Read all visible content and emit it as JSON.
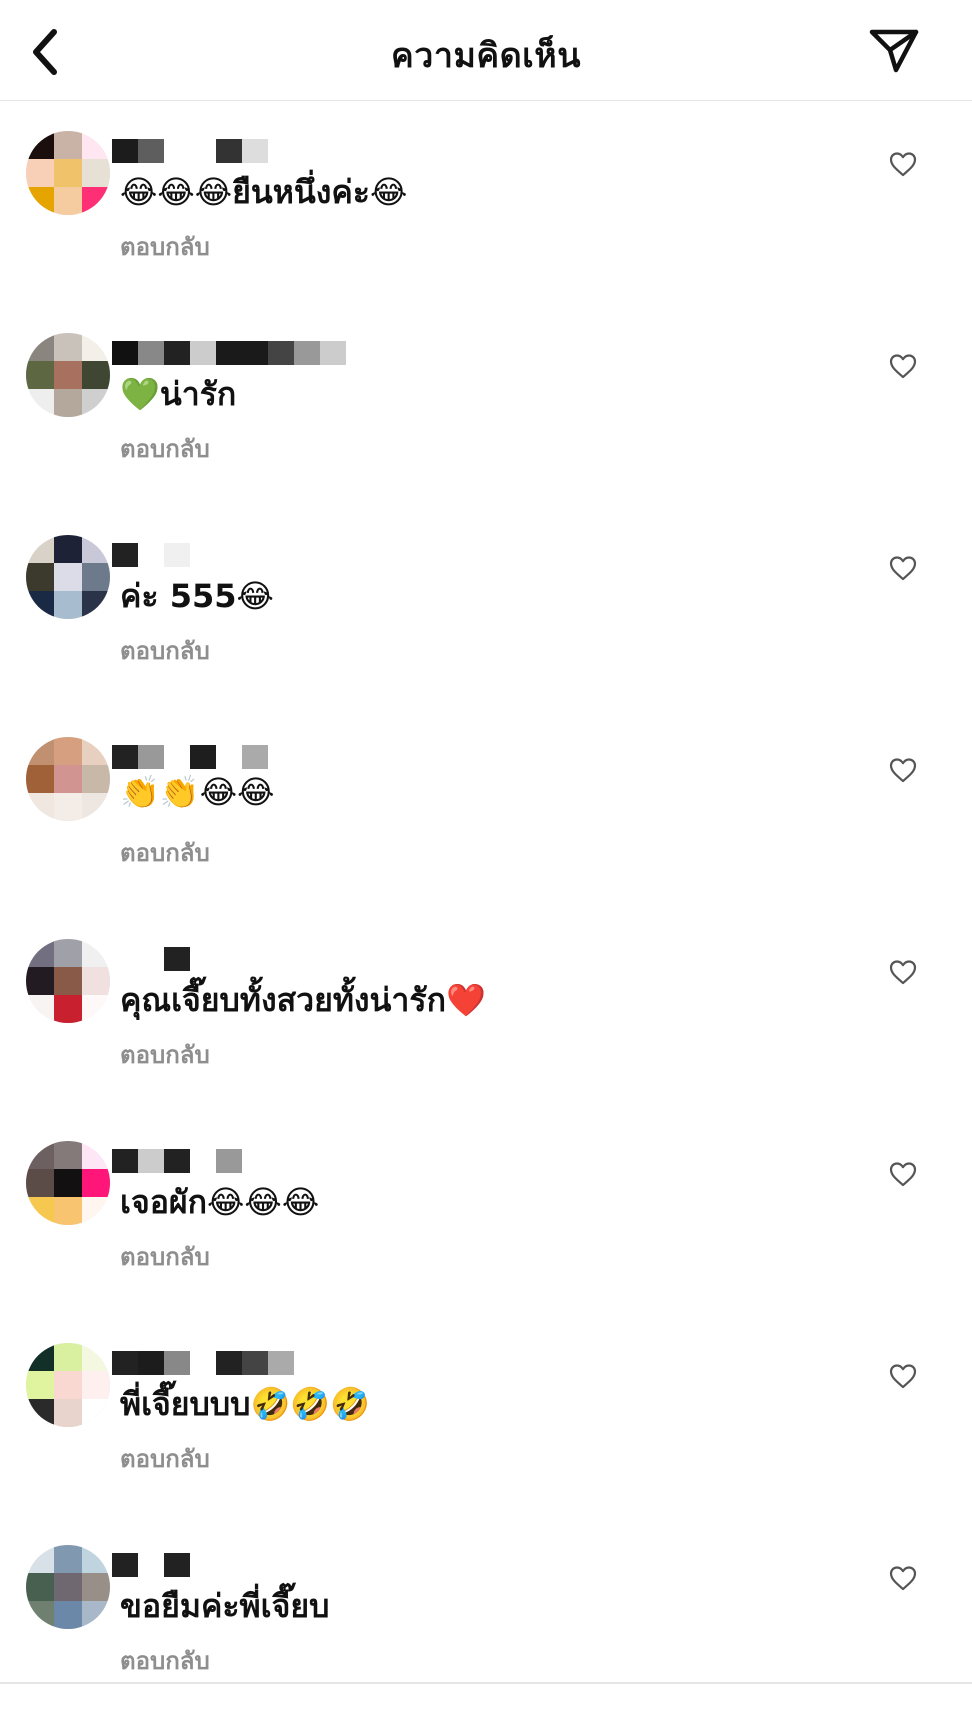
{
  "header": {
    "title": "ความคิดเห็น",
    "back_icon": "chevron-left-icon",
    "send_icon": "paper-plane-icon"
  },
  "comments": [
    {
      "text": "😂😂😂ยืนหนึ่งค่ะ😂",
      "reply": "ตอบกลับ",
      "avatar_colors": [
        "#1a0f0c",
        "#c9b3a6",
        "#ffe6f0",
        "#f8d0b8",
        "#f0c36a",
        "#e7e0d5",
        "#e6a400",
        "#f5cba0",
        "#ff2f75"
      ]
    },
    {
      "text": "💚น่ารัก",
      "reply": "ตอบกลับ",
      "avatar_colors": [
        "#8a857e",
        "#c8c2bb",
        "#f3efe9",
        "#5d6842",
        "#a8705e",
        "#3f4733",
        "#eeeeee",
        "#b4a89c",
        "#cfcfcf"
      ]
    },
    {
      "text": "ค่ะ 555😂",
      "reply": "ตอบกลับ",
      "avatar_colors": [
        "#d9d2c8",
        "#1d2236",
        "#c8c8d8",
        "#3b3a2c",
        "#dcdce8",
        "#6c7a8c",
        "#1a2a44",
        "#a8bcd0",
        "#2a3348"
      ]
    },
    {
      "text": "👏👏😂😂",
      "reply": "ตอบกลับ",
      "avatar_colors": [
        "#c09070",
        "#d6a080",
        "#e8d0c0",
        "#a06038",
        "#d29490",
        "#c8b8a8",
        "#f0e8e0",
        "#f4ece6",
        "#eee6e0"
      ]
    },
    {
      "text": "คุณเจี๊ยบทั้งสวยทั้งน่ารัก❤️",
      "reply": "ตอบกลับ",
      "avatar_colors": [
        "#727080",
        "#a0a0a8",
        "#f0f0f0",
        "#221c22",
        "#8a5a48",
        "#f0e0e0",
        "#f8f4f4",
        "#c8202e",
        "#fff8f8"
      ]
    },
    {
      "text": "เจอผัก😂😂😂",
      "reply": "ตอบกลับ",
      "avatar_colors": [
        "#6c6060",
        "#857a7a",
        "#ffe6f6",
        "#5c4c48",
        "#121010",
        "#ff1678",
        "#f6c850",
        "#f8c470",
        "#fff6f0"
      ]
    },
    {
      "text": "พี่เจี๊ยบบบ🤣🤣🤣",
      "reply": "ตอบกลับ",
      "avatar_colors": [
        "#123028",
        "#d8f0a0",
        "#f4f8e0",
        "#e0f4a0",
        "#f8d8d0",
        "#fff0f0",
        "#2a2a2a",
        "#e8d4cc",
        "#ffffff"
      ]
    },
    {
      "text": "ขอยืมค่ะพี่เจี๊ยบ",
      "reply": "ตอบกลับ",
      "avatar_colors": [
        "#d8e0e8",
        "#8098b0",
        "#c0d4e0",
        "#486050",
        "#706870",
        "#989088",
        "#708070",
        "#6c88a8",
        "#a8b8c8"
      ]
    }
  ],
  "username_blocks": [
    [
      "#1c1c1c",
      "#5e5e5e",
      "#ffffff",
      "#ffffff",
      "#333333",
      "#dddddd"
    ],
    [
      "#111111",
      "#888888",
      "#222222",
      "#cccccc",
      "#1a1a1a",
      "#1a1a1a",
      "#444444",
      "#999999",
      "#cccccc"
    ],
    [
      "#222222",
      "#ffffff",
      "#f0f0f0"
    ],
    [
      "#222222",
      "#999999",
      "#ffffff",
      "#1e1e1e",
      "#ffffff",
      "#aaaaaa"
    ],
    [
      "#ffffff",
      "#ffffff",
      "#222222"
    ],
    [
      "#222222",
      "#cccccc",
      "#222222",
      "#ffffff",
      "#999999"
    ],
    [
      "#222222",
      "#1c1c1c",
      "#888888",
      "#ffffff",
      "#222222",
      "#444444",
      "#aaaaaa"
    ],
    [
      "#222222",
      "#ffffff",
      "#222222"
    ]
  ],
  "heart_icon": "heart-outline-icon"
}
